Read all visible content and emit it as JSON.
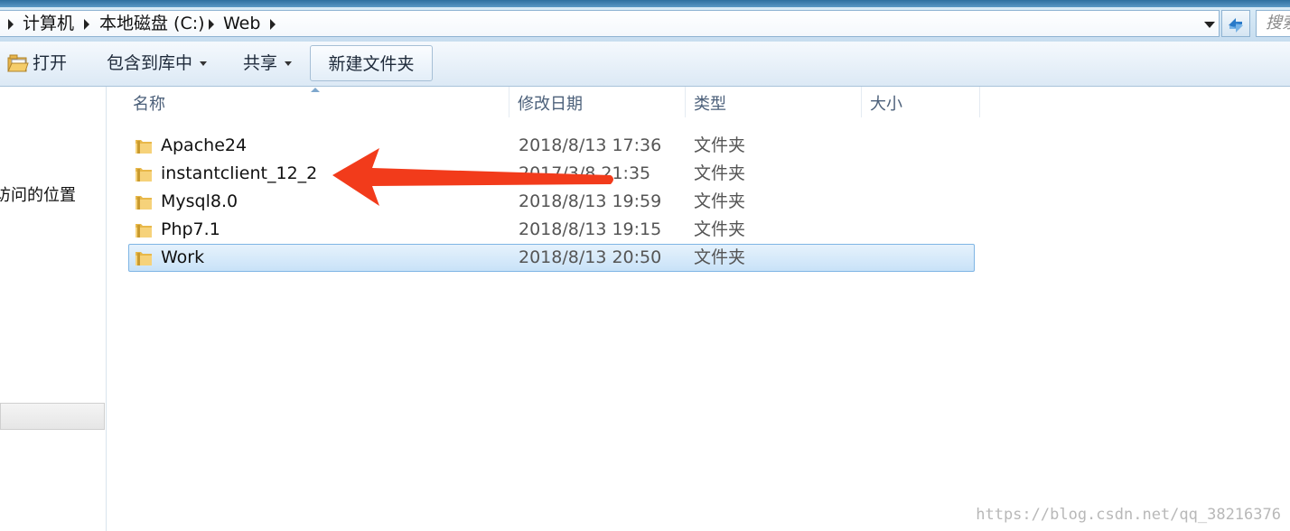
{
  "address_bar": {
    "crumbs": [
      "计算机",
      "本地磁盘 (C:)",
      "Web"
    ],
    "search_placeholder": "搜索"
  },
  "toolbar": {
    "open_label": "打开",
    "include_library_label": "包含到库中",
    "share_label": "共享",
    "new_folder_label": "新建文件夹"
  },
  "nav_pane": {
    "partial_item": "访问的位置"
  },
  "columns": {
    "name": "名称",
    "modified": "修改日期",
    "type": "类型",
    "size": "大小"
  },
  "files": [
    {
      "name": "Apache24",
      "modified": "2018/8/13 17:36",
      "type": "文件夹",
      "selected": false
    },
    {
      "name": "instantclient_12_2",
      "modified": "2017/3/8 21:35",
      "type": "文件夹",
      "selected": false
    },
    {
      "name": "Mysql8.0",
      "modified": "2018/8/13 19:59",
      "type": "文件夹",
      "selected": false
    },
    {
      "name": "Php7.1",
      "modified": "2018/8/13 19:15",
      "type": "文件夹",
      "selected": false
    },
    {
      "name": "Work",
      "modified": "2018/8/13 20:50",
      "type": "文件夹",
      "selected": true
    }
  ],
  "annotation": {
    "arrow_color": "#f23b1b",
    "points_to": "instantclient_12_2"
  },
  "watermark": "https://blog.csdn.net/qq_38216376",
  "colors": {
    "selection_fill": "#cde6fa",
    "selection_border": "#7fb5e4",
    "folder": "#e8b84a"
  }
}
